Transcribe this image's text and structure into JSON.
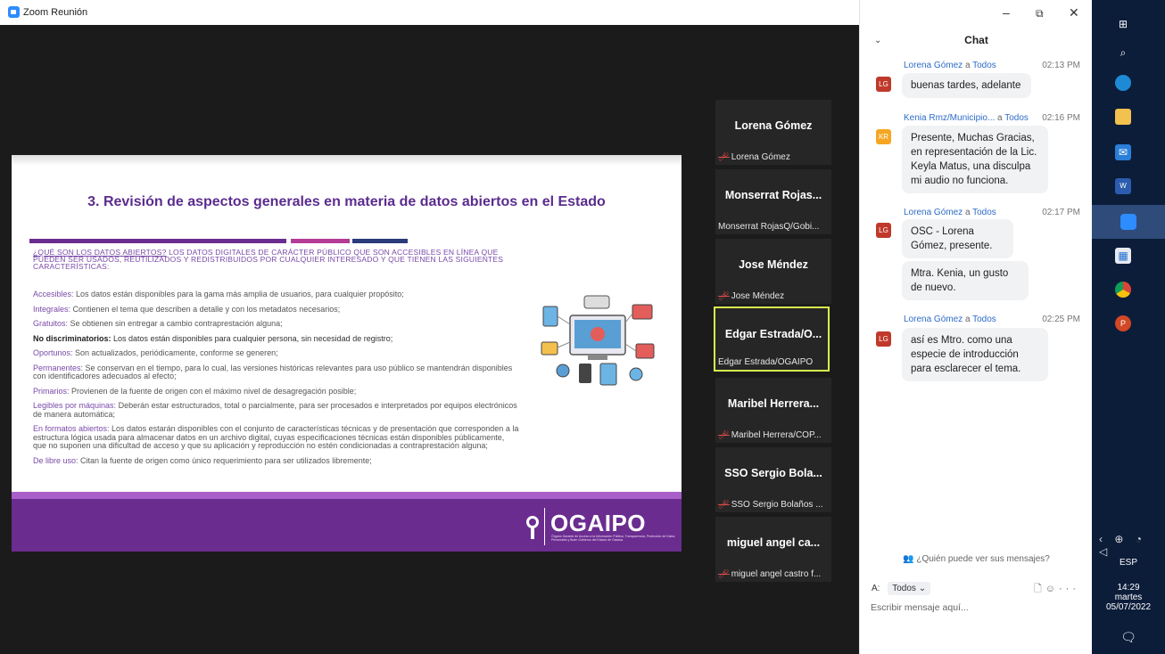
{
  "window": {
    "title": "Zoom Reunión",
    "min": "–",
    "max": "⧉",
    "close": "✕"
  },
  "slide": {
    "title": "3. Revisión de aspectos generales en materia de datos abiertos en el Estado",
    "intro_q": "¿QUÉ SON LOS DATOS ABIERTOS?",
    "intro_rest": " LOS DATOS DIGITALES DE CARÁCTER PÚBLICO QUE SON ACCESIBLES EN LÍNEA QUE PUEDEN SER USADOS, REUTILIZADOS Y REDISTRIBUIDOS POR CUALQUIER INTERESADO Y QUE TIENEN LAS SIGUIENTES CARACTERÍSTICAS:",
    "defs": [
      {
        "k": "Accesibles:",
        "t": " Los datos están disponibles para la gama más amplia de usuarios, para cualquier propósito;"
      },
      {
        "k": "Integrales:",
        "t": " Contienen el tema que describen a detalle y con los metadatos necesarios;"
      },
      {
        "k": "Gratuitos:",
        "t": " Se obtienen sin entregar a cambio contraprestación alguna;"
      },
      {
        "k": "No discriminatorios:",
        "t": " Los datos están disponibles para cualquier persona, sin necesidad de registro;",
        "bold": true
      },
      {
        "k": "Oportunos:",
        "t": " Son actualizados, periódicamente, conforme se generen;"
      },
      {
        "k": "Permanentes:",
        "t": " Se conservan en el tiempo, para lo cual, las versiones históricas relevantes para uso público se mantendrán disponibles con identificadores adecuados al efecto;"
      },
      {
        "k": "Primarios:",
        "t": " Provienen de la fuente de origen con el máximo nivel de desagregación posible;"
      },
      {
        "k": "Legibles por máquinas:",
        "t": " Deberán estar estructurados, total o parcialmente, para ser procesados e interpretados por equipos electrónicos de manera automática;"
      },
      {
        "k": "En formatos abiertos:",
        "t": " Los datos estarán disponibles con el conjunto de características técnicas y de presentación que corresponden a la estructura lógica usada para almacenar datos en un archivo digital, cuyas especificaciones técnicas están disponibles públicamente, que no suponen una dificultad de acceso y que su aplicación y reproducción no estén condicionadas a contraprestación alguna;"
      },
      {
        "k": "De libre uso:",
        "t": " Citan la fuente de origen como único requerimiento para ser utilizados libremente;"
      }
    ],
    "brand": "OGAIPO",
    "brand_sub": "Órgano Garante de Acceso a la Información Pública, Transparencia, Protección de Datos Personales y Buen Gobierno del Estado de Oaxaca",
    "colors": {
      "purple": "#6b2c90",
      "pink": "#b43c96",
      "navy": "#2a3b7a"
    }
  },
  "participants": [
    {
      "name": "Lorena Gómez",
      "label": "Lorena Gómez",
      "muted": true
    },
    {
      "name": "Monserrat Rojas...",
      "label": "Monserrat RojasQ/Gobi...",
      "muted": false
    },
    {
      "name": "Jose Méndez",
      "label": "Jose Méndez",
      "muted": true
    },
    {
      "name": "Edgar Estrada/O...",
      "label": "Edgar Estrada/OGAIPO",
      "muted": false,
      "active": true
    },
    {
      "name": "Maribel Herrera...",
      "label": "Maribel Herrera/COP...",
      "muted": true
    },
    {
      "name": "SSO Sergio Bola...",
      "label": "SSO Sergio Bolaños ...",
      "muted": true
    },
    {
      "name": "miguel angel ca...",
      "label": "miguel angel castro f...",
      "muted": true
    }
  ],
  "chat": {
    "title": "Chat",
    "messages": [
      {
        "from": "Lorena Gómez",
        "to": "Todos",
        "time": "02:13 PM",
        "initials": "LG",
        "color": "#c0392b",
        "texts": [
          "buenas tardes, adelante"
        ]
      },
      {
        "from": "Kenia Rmz/Municipio...",
        "to": "Todos",
        "time": "02:16 PM",
        "initials": "KR",
        "color": "#f5a623",
        "texts": [
          "Presente, Muchas Gracias, en representación de la Lic. Keyla Matus, una disculpa mi audio no funciona."
        ]
      },
      {
        "from": "Lorena Gómez",
        "to": "Todos",
        "time": "02:17 PM",
        "initials": "LG",
        "color": "#c0392b",
        "texts": [
          "OSC - Lorena Gómez, presente.",
          "Mtra. Kenia, un gusto de nuevo."
        ]
      },
      {
        "from": "Lorena Gómez",
        "to": "Todos",
        "time": "02:25 PM",
        "initials": "LG",
        "color": "#c0392b",
        "texts": [
          "así es Mtro. como una especie de introducción para esclarecer el tema."
        ]
      }
    ],
    "to_word": "a",
    "who_can_see": "¿Quién puede ver sus mensajes?",
    "to_label": "A:",
    "to_value": "Todos",
    "placeholder": "Escribir mensaje aquí..."
  },
  "taskbar": {
    "lang": "ESP",
    "time": "14:29",
    "day": "martes",
    "date": "05/07/2022"
  }
}
